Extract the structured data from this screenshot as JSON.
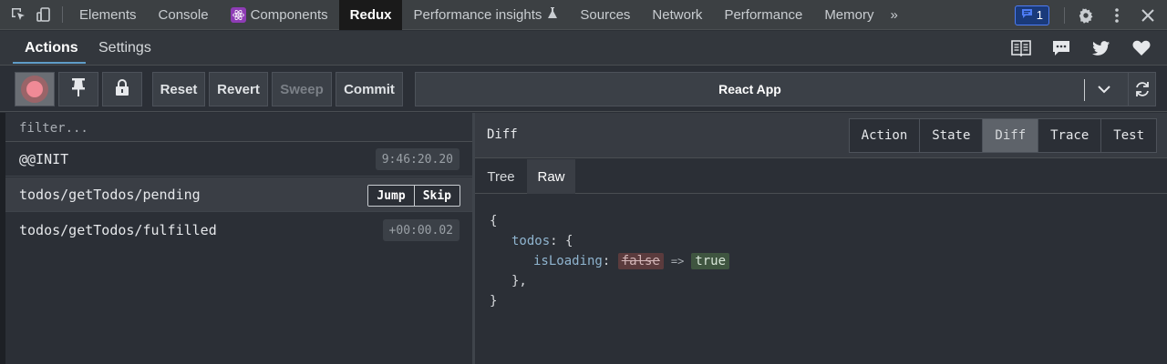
{
  "devtools": {
    "tabs": [
      {
        "label": "Elements"
      },
      {
        "label": "Console"
      },
      {
        "label": "Components"
      },
      {
        "label": "Redux"
      },
      {
        "label": "Performance insights"
      },
      {
        "label": "Sources"
      },
      {
        "label": "Network"
      },
      {
        "label": "Performance"
      },
      {
        "label": "Memory"
      }
    ],
    "active_tab": "Redux",
    "more_tabs": "»",
    "issues_count": "1"
  },
  "redux": {
    "tabs": [
      {
        "label": "Actions"
      },
      {
        "label": "Settings"
      }
    ],
    "active_tab": "Actions",
    "toolbar": {
      "reset": "Reset",
      "revert": "Revert",
      "sweep": "Sweep",
      "commit": "Commit",
      "instance": "React App"
    },
    "filter_placeholder": "filter...",
    "actions": [
      {
        "name": "@@INIT",
        "time": "9:46:20.20"
      },
      {
        "name": "todos/getTodos/pending",
        "jump": "Jump",
        "skip": "Skip"
      },
      {
        "name": "todos/getTodos/fulfilled",
        "time": "+00:00.02"
      }
    ],
    "monitor": {
      "title": "Diff",
      "tabs": [
        {
          "label": "Action"
        },
        {
          "label": "State"
        },
        {
          "label": "Diff"
        },
        {
          "label": "Trace"
        },
        {
          "label": "Test"
        }
      ],
      "active_tab": "Diff",
      "subtabs": [
        {
          "label": "Tree"
        },
        {
          "label": "Raw"
        }
      ],
      "active_subtab": "Raw",
      "diff": {
        "open_brace": "{",
        "key": "todos",
        "key_open": "{",
        "field": "isLoading",
        "old_value": "false",
        "arrow": "=>",
        "new_value": "true",
        "inner_close": "},",
        "close_brace": "}"
      }
    }
  },
  "colors": {
    "accent": "#5f9cc8",
    "record": "#f08a96",
    "diff_removed_bg": "#5b3b3d",
    "diff_added_bg": "#3f5540"
  }
}
